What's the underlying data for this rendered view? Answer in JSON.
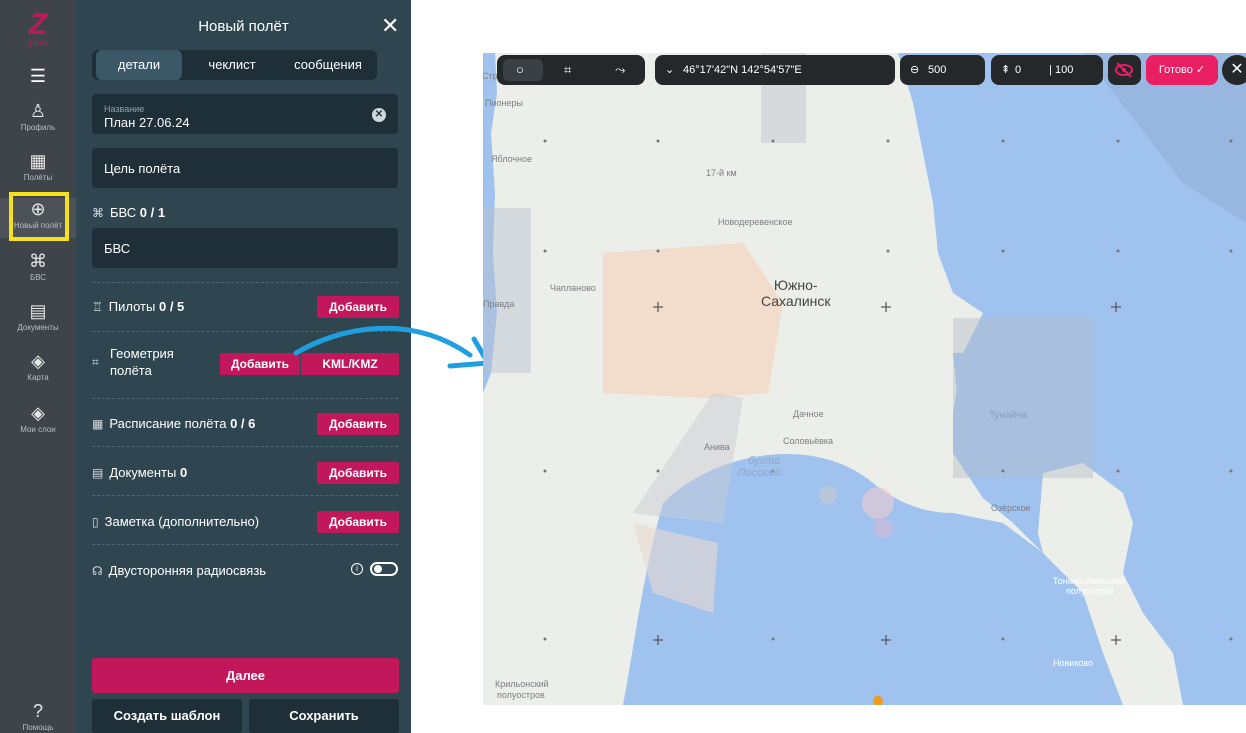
{
  "rail": {
    "logo_text": "Z",
    "logo_sub": "plus",
    "items": [
      {
        "label": "Профиль",
        "icon": "user-icon"
      },
      {
        "label": "Полёты",
        "icon": "calendar-icon"
      },
      {
        "label": "Новый полёт",
        "icon": "plus-circle-icon"
      },
      {
        "label": "БВС",
        "icon": "drone-icon"
      },
      {
        "label": "Документы",
        "icon": "clipboard-icon"
      },
      {
        "label": "Карта",
        "icon": "layers-icon"
      },
      {
        "label": "Мои слои",
        "icon": "layers-icon"
      },
      {
        "label": "Помощь",
        "icon": "help-icon"
      }
    ]
  },
  "panel": {
    "title": "Новый полёт",
    "tabs": [
      "детали",
      "чеклист",
      "сообщения"
    ],
    "name_label": "Название",
    "name_value": "План 27.06.24",
    "purpose_placeholder": "Цель полёта",
    "uav_label": "БВС",
    "uav_count": "0 / 1",
    "uav_placeholder": "БВС",
    "pilots_label": "Пилоты",
    "pilots_count": "0 / 5",
    "geometry_label_1": "Геометрия",
    "geometry_label_2": "полёта",
    "schedule_label": "Расписание полёта",
    "schedule_count": "0 / 6",
    "documents_label": "Документы",
    "documents_count": "0",
    "note_label": "Заметка (дополнительно)",
    "radio_label": "Двусторонняя радиосвязь",
    "add_label": "Добавить",
    "kml_label": "KML/KMZ",
    "next_label": "Далее",
    "template_label": "Создать шаблон",
    "save_label": "Сохранить"
  },
  "map_toolbar": {
    "coords": "46°17'42\"N 142°54'57\"E",
    "radius": "500",
    "alt_min": "0",
    "alt_max": "100",
    "done_label": "Готово"
  },
  "map": {
    "cities": [
      "Южно-",
      "Сахалинск"
    ],
    "places": [
      "Пионеры",
      "Яблочное",
      "17-й км",
      "Новодеревенское",
      "Чапланово",
      "Правда",
      "Дачное",
      "Соловьёвка",
      "Анива",
      "Озёрское",
      "Тунайча",
      "Тонино-Анивский",
      "полуостров",
      "Новиково",
      "Крильонский",
      "полуостров",
      "Стр"
    ],
    "water": [
      "бухта",
      "Лососей"
    ]
  },
  "colors": {
    "accent": "#c2185b",
    "panel_bg": "#2f4651",
    "rail_bg": "#3e4449",
    "water": "#9fc2ee",
    "highlight": "#f5e21b",
    "arrow": "#1f9fe0"
  }
}
